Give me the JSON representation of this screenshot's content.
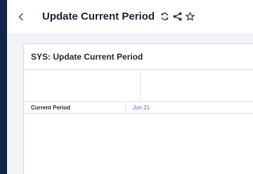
{
  "header": {
    "back_icon": "chevron-left-icon",
    "title": "Update Current Period",
    "icons": [
      "refresh-icon",
      "share-icon",
      "star-icon"
    ]
  },
  "card": {
    "title": "SYS: Update Current Period",
    "rows": [
      {
        "label": "Current Period",
        "value": "Jun 21"
      }
    ]
  },
  "colors": {
    "sidebar": "#0f2549",
    "content_bg": "#f2f3f7",
    "value_text": "#8a47c8"
  }
}
